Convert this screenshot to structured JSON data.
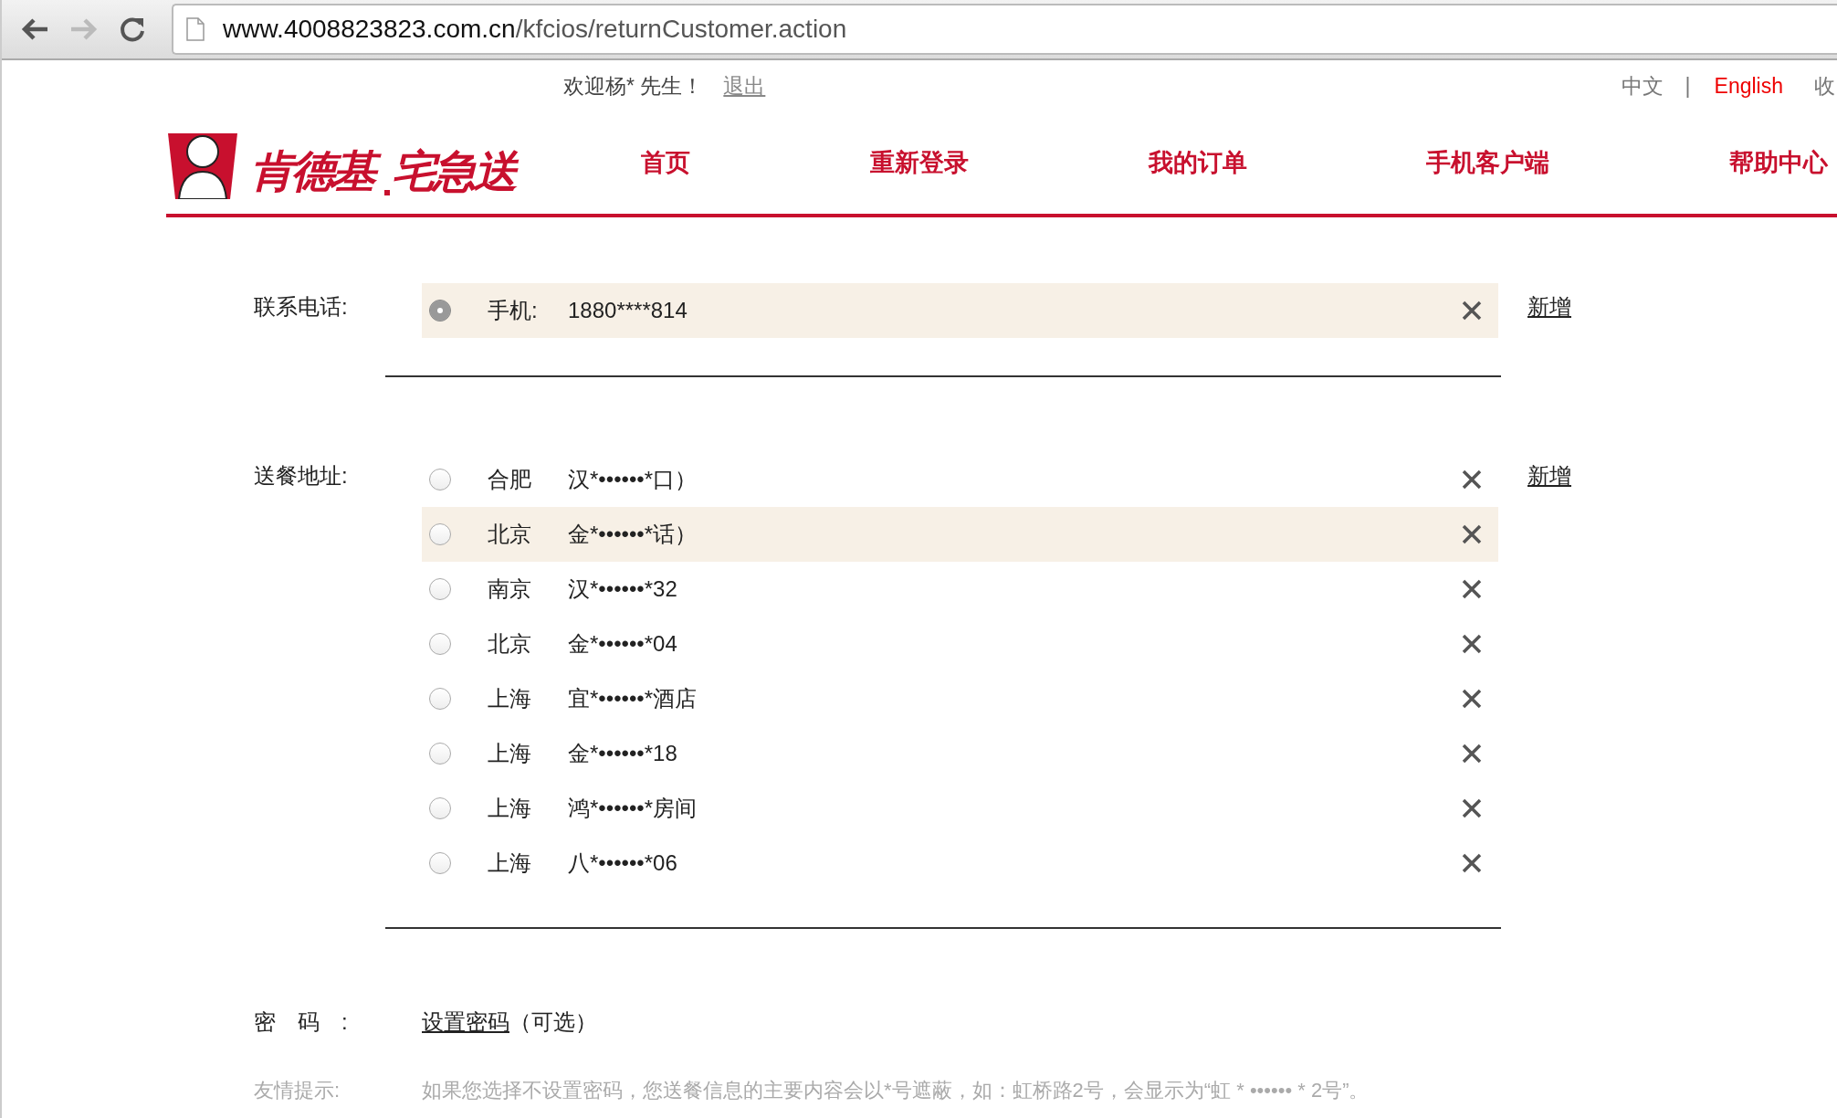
{
  "browser": {
    "url_host": "www.4008823823.com.cn",
    "url_path": "/kfcios/returnCustomer.action"
  },
  "header": {
    "welcome": "欢迎杨* 先生！",
    "logout": "退出",
    "languages": [
      {
        "label": "中文",
        "selected": false
      },
      {
        "label": "English",
        "selected": true
      }
    ],
    "separator": "|",
    "edge_link": "收",
    "logo": {
      "brand": "肯德基",
      "service": "宅急送"
    }
  },
  "nav": [
    {
      "label": "首页"
    },
    {
      "label": "重新登录"
    },
    {
      "label": "我的订单"
    },
    {
      "label": "手机客户端"
    },
    {
      "label": "帮助中心"
    }
  ],
  "phone": {
    "label": "联系电话:",
    "add": "新增",
    "items": [
      {
        "type_label": "手机:",
        "number": "1880****814",
        "selected": true,
        "highlighted": true
      }
    ]
  },
  "address": {
    "label": "送餐地址:",
    "add": "新增",
    "items": [
      {
        "city": "合肥",
        "address": "汉*••••••*口）",
        "selected": false,
        "highlighted": false
      },
      {
        "city": "北京",
        "address": "金*••••••*话）",
        "selected": false,
        "highlighted": true
      },
      {
        "city": "南京",
        "address": "汉*••••••*32",
        "selected": false,
        "highlighted": false
      },
      {
        "city": "北京",
        "address": "金*••••••*04",
        "selected": false,
        "highlighted": false
      },
      {
        "city": "上海",
        "address": "宜*••••••*酒店",
        "selected": false,
        "highlighted": false
      },
      {
        "city": "上海",
        "address": "金*••••••*18",
        "selected": false,
        "highlighted": false
      },
      {
        "city": "上海",
        "address": "鸿*••••••*房间",
        "selected": false,
        "highlighted": false
      },
      {
        "city": "上海",
        "address": "八*••••••*06",
        "selected": false,
        "highlighted": false
      }
    ]
  },
  "password": {
    "label": "密　码　:",
    "link": "设置密码",
    "note": "（可选）"
  },
  "tip": {
    "label": "友情提示:",
    "text": "如果您选择不设置密码，您送餐信息的主要内容会以*号遮蔽，如：虹桥路2号，会显示为“虹 * •••••• * 2号”。"
  }
}
